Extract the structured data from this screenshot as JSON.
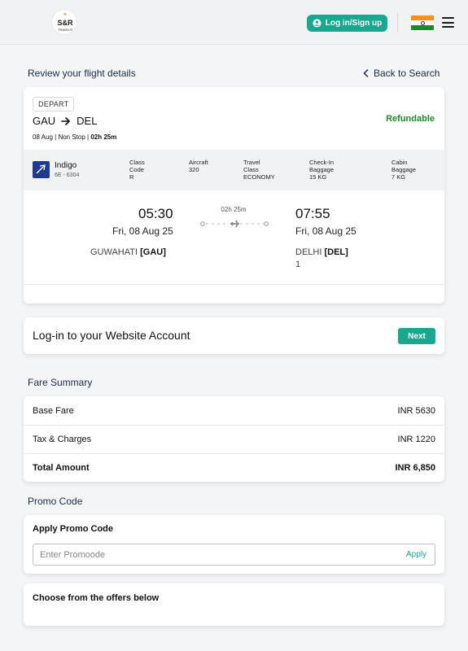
{
  "header": {
    "logo_text": "S&R",
    "logo_sub": "TRAVELS",
    "login_label": "Log in/Sign up",
    "country": "India",
    "flag_colors": [
      "#f5901e",
      "#ffffff",
      "#1a8a2e"
    ]
  },
  "review": {
    "title": "Review your flight details",
    "back_label": "Back to Search"
  },
  "flight": {
    "badge": "DEPART",
    "from": "GAU",
    "to": "DEL",
    "date_short": "08 Aug",
    "stops": "Non Stop",
    "duration": "02h  25m",
    "refund_status": "Refundable",
    "airline": {
      "name": "Indigo",
      "code": "6E - 6304",
      "details": [
        {
          "label": "Class\nCode",
          "value": "R"
        },
        {
          "label": "Aircraft",
          "value": "320"
        },
        {
          "label": "Travel\nClass",
          "value": "ECONOMY"
        },
        {
          "label": "Check-In\nBaggage",
          "value": "15 KG"
        },
        {
          "label": "Cabin\nBaggage",
          "value": "7 KG"
        }
      ]
    },
    "departure": {
      "time": "05:30",
      "date": "Fri, 08 Aug 25",
      "city": "GUWAHATI",
      "code": "[GAU]"
    },
    "arrival": {
      "time": "07:55",
      "date": "Fri, 08 Aug 25",
      "city": "DELHI",
      "code": "[DEL]",
      "terminal": "1"
    },
    "leg_duration": "02h  25m"
  },
  "account": {
    "title": "Log-in to your Website Account",
    "next_label": "Next"
  },
  "fare": {
    "title": "Fare Summary",
    "rows": [
      {
        "label": "Base Fare",
        "value": "INR 5630"
      },
      {
        "label": "Tax & Charges",
        "value": "INR 1220"
      },
      {
        "label": "Total Amount",
        "value": "INR 6,850"
      }
    ]
  },
  "promo": {
    "title": "Promo Code",
    "card_label": "Apply Promo Code",
    "placeholder": "Enter Promoode",
    "value": "",
    "apply_label": "Apply"
  },
  "offers": {
    "title": "Choose from the offers below"
  },
  "colors": {
    "accent": "#18a88f",
    "refundable": "#1e8a2a",
    "navy": "#1c2b4a"
  }
}
